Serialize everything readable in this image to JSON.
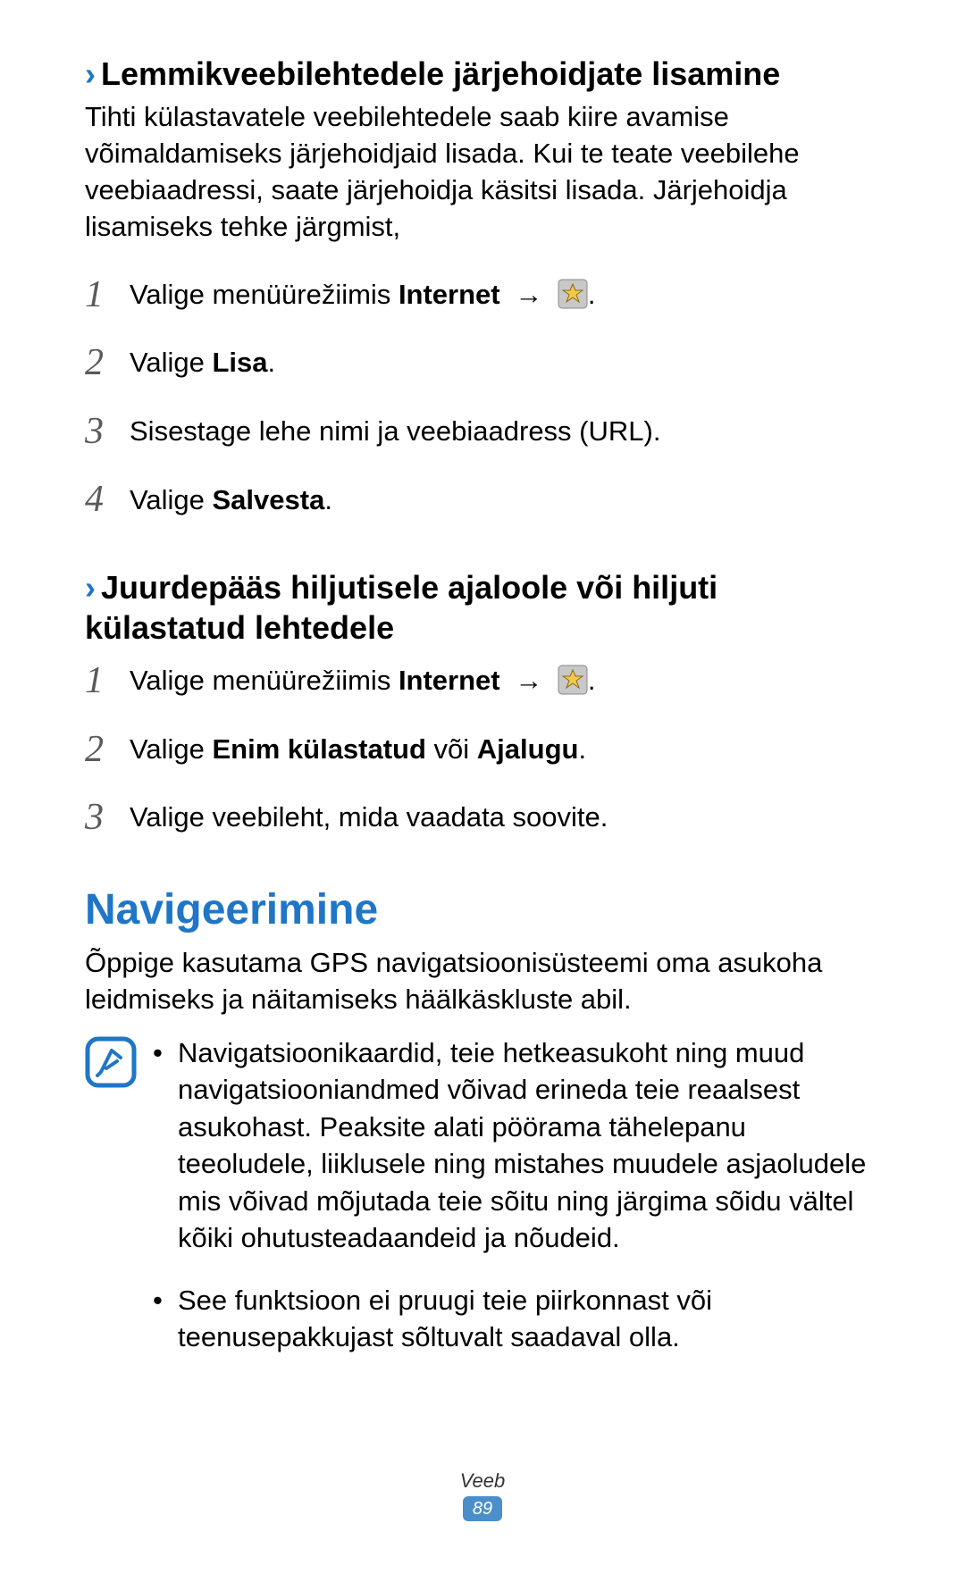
{
  "section1": {
    "heading": "Lemmikveebilehtedele järjehoidjate lisamine",
    "body": "Tihti külastavatele veebilehtedele saab kiire avamise võimaldamiseks järjehoidjaid lisada. Kui te teate veebilehe veebiaadressi, saate järjehoidja käsitsi lisada. Järjehoidja lisamiseks tehke järgmist,",
    "steps": {
      "s1_prefix": "Valige menüürežiimis ",
      "s1_bold": "Internet",
      "s1_arrow": " → ",
      "s2_prefix": "Valige ",
      "s2_bold": "Lisa",
      "s2_suffix": ".",
      "s3": "Sisestage lehe nimi ja veebiaadress (URL).",
      "s4_prefix": "Valige ",
      "s4_bold": "Salvesta",
      "s4_suffix": "."
    }
  },
  "section2": {
    "heading": "Juurdepääs hiljutisele ajaloole või hiljuti külastatud lehtedele",
    "steps": {
      "s1_prefix": "Valige menüürežiimis ",
      "s1_bold": "Internet",
      "s1_arrow": " → ",
      "s2_prefix": "Valige ",
      "s2_bold1": "Enim külastatud",
      "s2_mid": " või ",
      "s2_bold2": "Ajalugu",
      "s2_suffix": ".",
      "s3": "Valige veebileht, mida vaadata soovite."
    }
  },
  "nav": {
    "heading": "Navigeerimine",
    "body": "Õppige kasutama GPS navigatsioonisüsteemi oma asukoha leidmiseks ja näitamiseks häälkäskluste abil.",
    "notes": {
      "n1": "Navigatsioonikaardid, teie hetkeasukoht ning muud navigatsiooniandmed võivad erineda teie reaalsest asukohast. Peaksite alati pöörama tähelepanu teeoludele, liiklusele ning mistahes muudele asjaoludele mis võivad mõjutada teie sõitu ning järgima sõidu vältel kõiki ohutusteadaandeid ja nõudeid.",
      "n2": "See funktsioon ei pruugi teie piirkonnast või teenusepakkujast sõltuvalt saadaval olla."
    }
  },
  "footer": {
    "label": "Veeb",
    "page": "89"
  },
  "nums": {
    "n1": "1",
    "n2": "2",
    "n3": "3",
    "n4": "4"
  }
}
